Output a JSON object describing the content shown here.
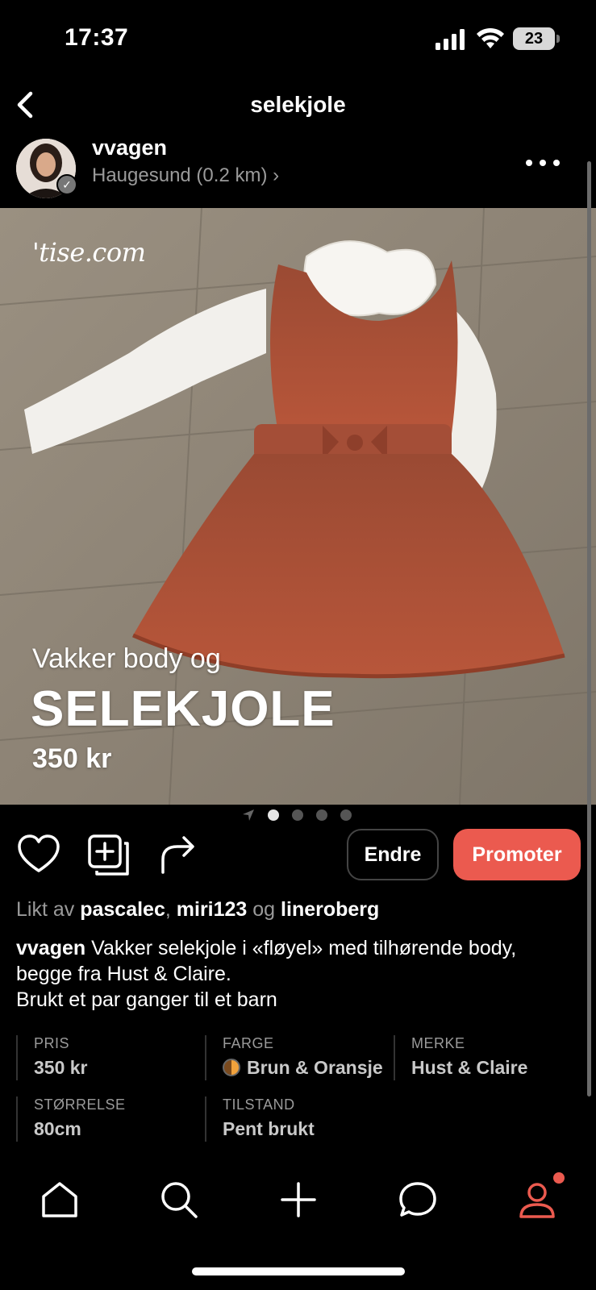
{
  "status": {
    "time": "17:37",
    "battery": "23"
  },
  "nav": {
    "title": "selekjole"
  },
  "seller": {
    "name": "vvagen",
    "location": "Haugesund (0.2 km) ›"
  },
  "photo": {
    "watermark": "'tise.com",
    "overlay_sub": "Vakker body og",
    "overlay_title": "SELEKJOLE",
    "overlay_price": "350 kr",
    "page_count": 4,
    "active_page": 1
  },
  "actions": {
    "edit_label": "Endre",
    "promote_label": "Promoter"
  },
  "liked": {
    "prefix": "Likt av",
    "users": [
      "pascalec",
      "miri123",
      "lineroberg"
    ],
    "sep": ",",
    "and": "og"
  },
  "description": {
    "author": "vvagen",
    "line1": "Vakker selekjole i «fløyel» med tilhørende body,",
    "line2": "begge fra Hust & Claire.",
    "line3": "Brukt et par ganger til et barn"
  },
  "details": [
    {
      "label": "PRIS",
      "value": "350 kr"
    },
    {
      "label": "FARGE",
      "value": "Brun & Oransje"
    },
    {
      "label": "MERKE",
      "value": "Hust & Claire"
    },
    {
      "label": "STØRRELSE",
      "value": "80cm"
    },
    {
      "label": "TILSTAND",
      "value": "Pent brukt"
    }
  ],
  "colors": {
    "accent": "#eb5a4f",
    "muted": "#9a9a9a",
    "background": "#000000"
  },
  "tabbar": {
    "icons": [
      "home-icon",
      "search-icon",
      "plus-icon",
      "chat-icon",
      "profile-icon"
    ],
    "active": "profile-icon"
  }
}
